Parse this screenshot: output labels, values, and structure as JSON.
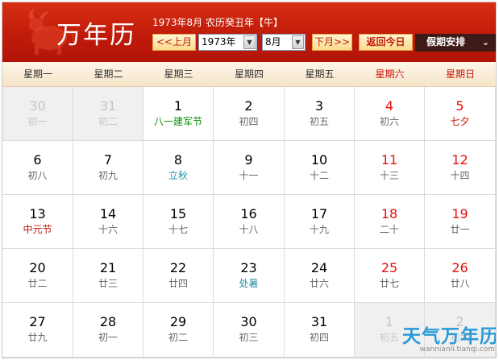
{
  "header": {
    "title": "万年历",
    "info": "1973年8月 农历癸丑年【牛】",
    "prev_label": "<<上月",
    "next_label": "下月>>",
    "today_label": "返回今日",
    "holiday_label": "假期安排",
    "year_value": "1973年",
    "month_value": "8月",
    "accent": "#c11b0a"
  },
  "weekdays": [
    "星期一",
    "星期二",
    "星期三",
    "星期四",
    "星期五",
    "星期六",
    "星期日"
  ],
  "weeks": [
    [
      {
        "day": "30",
        "lunar": "初一",
        "other": true
      },
      {
        "day": "31",
        "lunar": "初二",
        "other": true
      },
      {
        "day": "1",
        "lunar": "八一建军节",
        "style": "festival-green"
      },
      {
        "day": "2",
        "lunar": "初四"
      },
      {
        "day": "3",
        "lunar": "初五"
      },
      {
        "day": "4",
        "lunar": "初六"
      },
      {
        "day": "5",
        "lunar": "七夕",
        "style": "festival-red"
      }
    ],
    [
      {
        "day": "6",
        "lunar": "初八"
      },
      {
        "day": "7",
        "lunar": "初九"
      },
      {
        "day": "8",
        "lunar": "立秋",
        "style": "term"
      },
      {
        "day": "9",
        "lunar": "十一"
      },
      {
        "day": "10",
        "lunar": "十二"
      },
      {
        "day": "11",
        "lunar": "十三"
      },
      {
        "day": "12",
        "lunar": "十四"
      }
    ],
    [
      {
        "day": "13",
        "lunar": "中元节",
        "style": "festival-red"
      },
      {
        "day": "14",
        "lunar": "十六"
      },
      {
        "day": "15",
        "lunar": "十七"
      },
      {
        "day": "16",
        "lunar": "十八"
      },
      {
        "day": "17",
        "lunar": "十九"
      },
      {
        "day": "18",
        "lunar": "二十"
      },
      {
        "day": "19",
        "lunar": "廿一"
      }
    ],
    [
      {
        "day": "20",
        "lunar": "廿二"
      },
      {
        "day": "21",
        "lunar": "廿三"
      },
      {
        "day": "22",
        "lunar": "廿四"
      },
      {
        "day": "23",
        "lunar": "处暑",
        "style": "term"
      },
      {
        "day": "24",
        "lunar": "廿六"
      },
      {
        "day": "25",
        "lunar": "廿七"
      },
      {
        "day": "26",
        "lunar": "廿八"
      }
    ],
    [
      {
        "day": "27",
        "lunar": "廿九"
      },
      {
        "day": "28",
        "lunar": "初一"
      },
      {
        "day": "29",
        "lunar": "初二"
      },
      {
        "day": "30",
        "lunar": "初三"
      },
      {
        "day": "31",
        "lunar": "初四"
      },
      {
        "day": "1",
        "lunar": "初五",
        "other": true
      },
      {
        "day": "2",
        "lunar": "初六",
        "other": true
      }
    ]
  ],
  "watermark": {
    "title": "天气万年历",
    "url": "wannianli.tianqi.com"
  }
}
